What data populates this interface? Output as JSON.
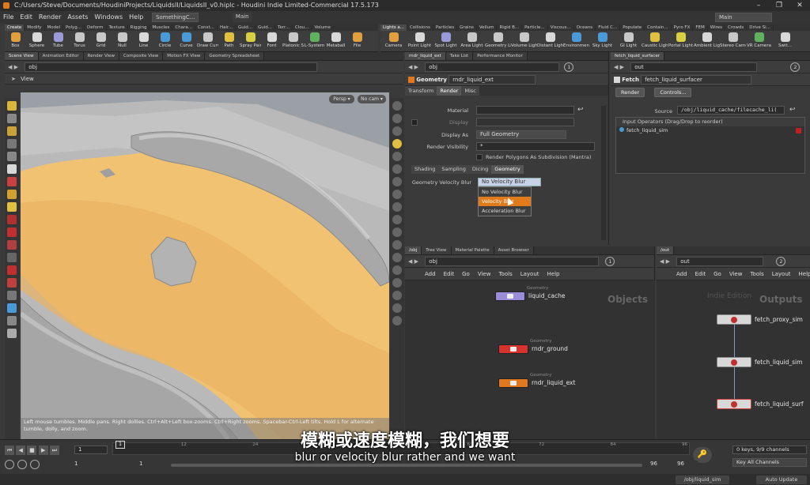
{
  "window": {
    "title": "C:/Users/Steve/Documents/HoudiniProjects/LiquidsII/LiquidsII_v0.hiplc - Houdini Indie Limited-Commercial 17.5.173",
    "min": "–",
    "max": "❐",
    "close": "✕"
  },
  "menu": {
    "items": [
      "File",
      "Edit",
      "Render",
      "Assets",
      "Windows",
      "Help"
    ],
    "desktop": "SomethingC...",
    "build": "Main",
    "right_desktop": "Main"
  },
  "shelf_left": {
    "tabs": [
      "Create",
      "Modify",
      "Model",
      "Polyg...",
      "Deform",
      "Texture",
      "Rigging",
      "Muscles",
      "Chara...",
      "Const...",
      "Hair...",
      "Guid...",
      "Guid...",
      "Terr...",
      "Clou...",
      "Volume"
    ],
    "tools": [
      "Box",
      "Sphere",
      "Tube",
      "Torus",
      "Grid",
      "Null",
      "Line",
      "Circle",
      "Curve",
      "Draw Curve",
      "Path",
      "Spray Paint",
      "Font",
      "Platonic Solids",
      "L-System",
      "Metaball",
      "File"
    ]
  },
  "shelf_right": {
    "tabs": [
      "Lights a...",
      "Collisions",
      "Particles",
      "Grains",
      "Vellum",
      "Rigid B...",
      "Particle...",
      "Viscous...",
      "Oceans",
      "Fluid C...",
      "Populate",
      "Contain...",
      "Pyro FX",
      "FEM",
      "Wires",
      "Crowds",
      "Drive Si..."
    ],
    "tools": [
      "Camera",
      "Point Light",
      "Spot Light",
      "Area Light",
      "Geometry Light",
      "Volume Light",
      "Distant Light",
      "Environment Light",
      "Sky Light",
      "GI Light",
      "Caustic Light",
      "Portal Light",
      "Ambient Light",
      "Stereo Camera",
      "VR Camera",
      "Swit..."
    ]
  },
  "viewport": {
    "tabs": [
      "Scene View",
      "Animation Editor",
      "Render View",
      "Composite View",
      "Motion FX View",
      "Geometry Spreadsheet"
    ],
    "path": "obj",
    "label": "View",
    "persp": "Persp ▾",
    "cam": "No cam ▾",
    "help": "Left mouse tumbles. Middle pans. Right dollies. Ctrl+Alt+Left box-zooms. Ctrl+Right zooms. Spacebar-Ctrl-Left tilts. Hold L for alternate tumble, dolly, and zoom."
  },
  "params": {
    "tabs": [
      "rndr_liquid_ext",
      "Take List",
      "Performance Monitor"
    ],
    "path": "obj",
    "node_type": "Geometry",
    "node_name": "rndr_liquid_ext",
    "subtabs": [
      "Transform",
      "Render",
      "Misc"
    ],
    "material_label": "Material",
    "display_label": "Display",
    "display_as_label": "Display As",
    "display_as_value": "Full Geometry",
    "render_vis_label": "Render Visibility",
    "render_vis_value": "*",
    "subdiv_label": "Render Polygons As Subdivision (Mantra)",
    "render_tabs": [
      "Shading",
      "Sampling",
      "Dicing",
      "Geometry"
    ],
    "vel_blur_label": "Geometry Velocity Blur",
    "vel_blur_value": "No Velocity Blur",
    "dropdown_options": [
      "No Velocity Blur",
      "Velocity Blur",
      "Acceleration Blur"
    ]
  },
  "fetch": {
    "tabs": [
      "fetch_liquid_surfacer"
    ],
    "path": "out",
    "node_type": "Fetch",
    "node_name": "fetch_liquid_surfacer",
    "render_btn": "Render",
    "controls_btn": "Controls...",
    "source_label": "Source",
    "source_value": "/obj/liquid_cache/filecache_li(",
    "input_ops_label": "Input Operators (Drag/Drop to reorder)",
    "input_op": "fetch_liquid_sim"
  },
  "net_obj": {
    "tabs": [
      "/obj",
      "Tree View",
      "Material Palette",
      "Asset Browser"
    ],
    "path": "obj",
    "menu": [
      "Add",
      "Edit",
      "Go",
      "View",
      "Tools",
      "Layout",
      "Help"
    ],
    "watermark": "Objects",
    "nodes": [
      {
        "type": "Geometry",
        "name": "liquid_cache",
        "color": "#9a8cd8"
      },
      {
        "type": "Geometry",
        "name": "rndr_ground",
        "color": "#d8322e"
      },
      {
        "type": "Geometry",
        "name": "rndr_liquid_ext",
        "color": "#e0781e"
      }
    ]
  },
  "net_out": {
    "tabs": [
      "/out"
    ],
    "path": "out",
    "menu": [
      "Add",
      "Edit",
      "Go",
      "View",
      "Tools",
      "Layout",
      "Help"
    ],
    "watermark": "Outputs",
    "indie": "Indie Edition",
    "nodes": [
      {
        "name": "fetch_proxy_sim"
      },
      {
        "name": "fetch_liquid_sim"
      },
      {
        "name": "fetch_liquid_surf"
      }
    ]
  },
  "timeline": {
    "frame": "1",
    "start": "1",
    "start2": "1",
    "end": "96",
    "end2": "96",
    "ticks": [
      "12",
      "24",
      "36",
      "48",
      "60",
      "72",
      "84",
      "96"
    ],
    "keys_info": "0 keys, 9/9 channels",
    "key_all": "Key All Channels",
    "obj_path": "/obj/liquid_sim",
    "auto_update": "Auto Update"
  },
  "subtitles": {
    "cn": "模糊或速度模糊，我们想要",
    "en": "blur or velocity blur rather and we want"
  }
}
